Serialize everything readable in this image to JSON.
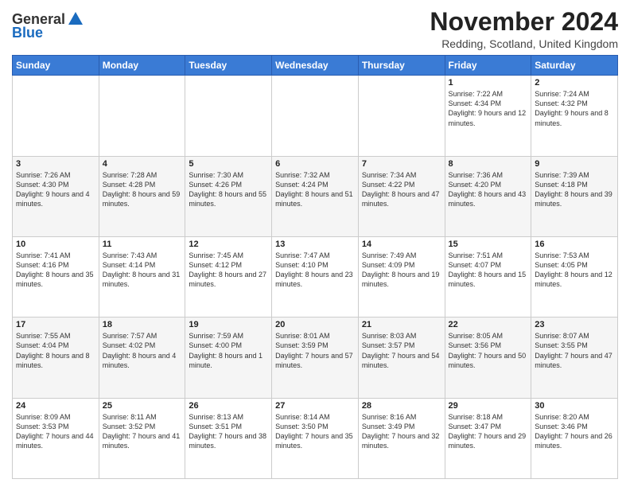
{
  "header": {
    "logo_line1": "General",
    "logo_line2": "Blue",
    "month_title": "November 2024",
    "location": "Redding, Scotland, United Kingdom"
  },
  "days_of_week": [
    "Sunday",
    "Monday",
    "Tuesday",
    "Wednesday",
    "Thursday",
    "Friday",
    "Saturday"
  ],
  "weeks": [
    [
      {
        "day": "",
        "info": ""
      },
      {
        "day": "",
        "info": ""
      },
      {
        "day": "",
        "info": ""
      },
      {
        "day": "",
        "info": ""
      },
      {
        "day": "",
        "info": ""
      },
      {
        "day": "1",
        "info": "Sunrise: 7:22 AM\nSunset: 4:34 PM\nDaylight: 9 hours and 12 minutes."
      },
      {
        "day": "2",
        "info": "Sunrise: 7:24 AM\nSunset: 4:32 PM\nDaylight: 9 hours and 8 minutes."
      }
    ],
    [
      {
        "day": "3",
        "info": "Sunrise: 7:26 AM\nSunset: 4:30 PM\nDaylight: 9 hours and 4 minutes."
      },
      {
        "day": "4",
        "info": "Sunrise: 7:28 AM\nSunset: 4:28 PM\nDaylight: 8 hours and 59 minutes."
      },
      {
        "day": "5",
        "info": "Sunrise: 7:30 AM\nSunset: 4:26 PM\nDaylight: 8 hours and 55 minutes."
      },
      {
        "day": "6",
        "info": "Sunrise: 7:32 AM\nSunset: 4:24 PM\nDaylight: 8 hours and 51 minutes."
      },
      {
        "day": "7",
        "info": "Sunrise: 7:34 AM\nSunset: 4:22 PM\nDaylight: 8 hours and 47 minutes."
      },
      {
        "day": "8",
        "info": "Sunrise: 7:36 AM\nSunset: 4:20 PM\nDaylight: 8 hours and 43 minutes."
      },
      {
        "day": "9",
        "info": "Sunrise: 7:39 AM\nSunset: 4:18 PM\nDaylight: 8 hours and 39 minutes."
      }
    ],
    [
      {
        "day": "10",
        "info": "Sunrise: 7:41 AM\nSunset: 4:16 PM\nDaylight: 8 hours and 35 minutes."
      },
      {
        "day": "11",
        "info": "Sunrise: 7:43 AM\nSunset: 4:14 PM\nDaylight: 8 hours and 31 minutes."
      },
      {
        "day": "12",
        "info": "Sunrise: 7:45 AM\nSunset: 4:12 PM\nDaylight: 8 hours and 27 minutes."
      },
      {
        "day": "13",
        "info": "Sunrise: 7:47 AM\nSunset: 4:10 PM\nDaylight: 8 hours and 23 minutes."
      },
      {
        "day": "14",
        "info": "Sunrise: 7:49 AM\nSunset: 4:09 PM\nDaylight: 8 hours and 19 minutes."
      },
      {
        "day": "15",
        "info": "Sunrise: 7:51 AM\nSunset: 4:07 PM\nDaylight: 8 hours and 15 minutes."
      },
      {
        "day": "16",
        "info": "Sunrise: 7:53 AM\nSunset: 4:05 PM\nDaylight: 8 hours and 12 minutes."
      }
    ],
    [
      {
        "day": "17",
        "info": "Sunrise: 7:55 AM\nSunset: 4:04 PM\nDaylight: 8 hours and 8 minutes."
      },
      {
        "day": "18",
        "info": "Sunrise: 7:57 AM\nSunset: 4:02 PM\nDaylight: 8 hours and 4 minutes."
      },
      {
        "day": "19",
        "info": "Sunrise: 7:59 AM\nSunset: 4:00 PM\nDaylight: 8 hours and 1 minute."
      },
      {
        "day": "20",
        "info": "Sunrise: 8:01 AM\nSunset: 3:59 PM\nDaylight: 7 hours and 57 minutes."
      },
      {
        "day": "21",
        "info": "Sunrise: 8:03 AM\nSunset: 3:57 PM\nDaylight: 7 hours and 54 minutes."
      },
      {
        "day": "22",
        "info": "Sunrise: 8:05 AM\nSunset: 3:56 PM\nDaylight: 7 hours and 50 minutes."
      },
      {
        "day": "23",
        "info": "Sunrise: 8:07 AM\nSunset: 3:55 PM\nDaylight: 7 hours and 47 minutes."
      }
    ],
    [
      {
        "day": "24",
        "info": "Sunrise: 8:09 AM\nSunset: 3:53 PM\nDaylight: 7 hours and 44 minutes."
      },
      {
        "day": "25",
        "info": "Sunrise: 8:11 AM\nSunset: 3:52 PM\nDaylight: 7 hours and 41 minutes."
      },
      {
        "day": "26",
        "info": "Sunrise: 8:13 AM\nSunset: 3:51 PM\nDaylight: 7 hours and 38 minutes."
      },
      {
        "day": "27",
        "info": "Sunrise: 8:14 AM\nSunset: 3:50 PM\nDaylight: 7 hours and 35 minutes."
      },
      {
        "day": "28",
        "info": "Sunrise: 8:16 AM\nSunset: 3:49 PM\nDaylight: 7 hours and 32 minutes."
      },
      {
        "day": "29",
        "info": "Sunrise: 8:18 AM\nSunset: 3:47 PM\nDaylight: 7 hours and 29 minutes."
      },
      {
        "day": "30",
        "info": "Sunrise: 8:20 AM\nSunset: 3:46 PM\nDaylight: 7 hours and 26 minutes."
      }
    ]
  ]
}
